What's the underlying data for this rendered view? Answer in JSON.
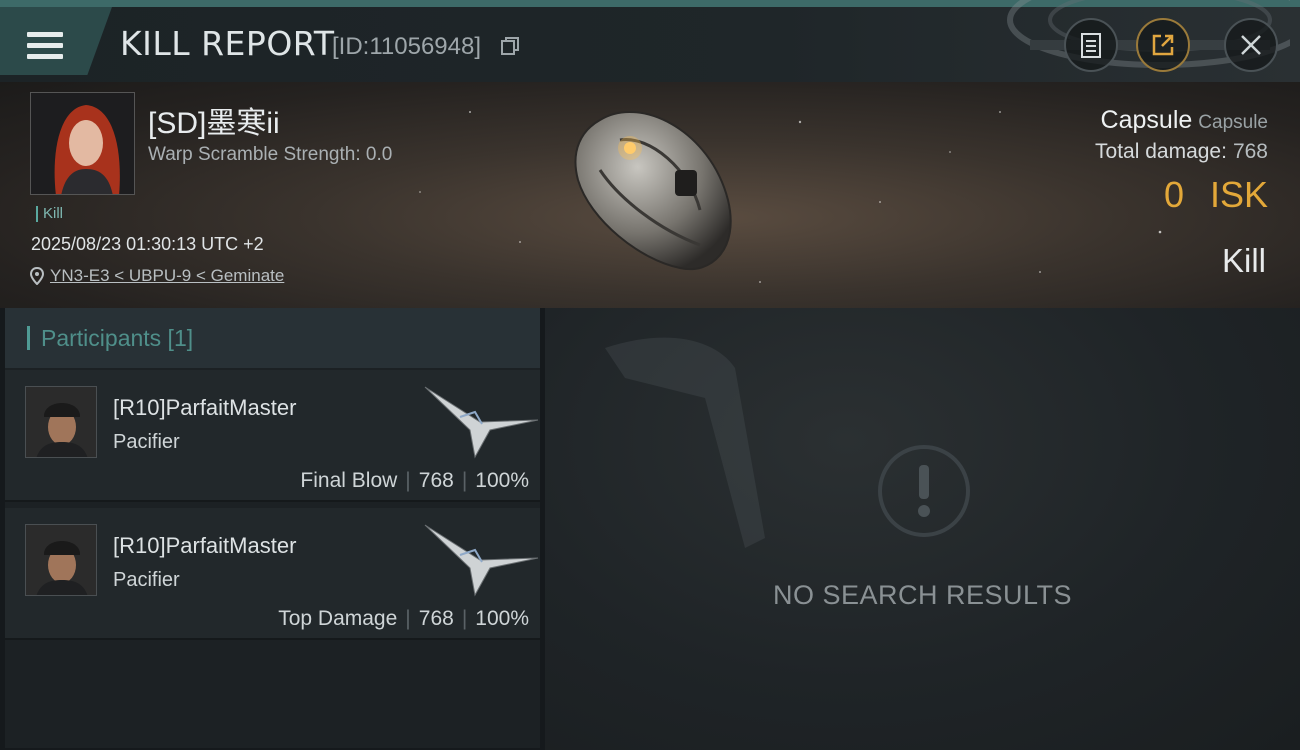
{
  "header": {
    "title": "KILL REPORT",
    "report_id": "[ID:11056948]",
    "icons": [
      "menu-icon",
      "copy-icon",
      "clipboard-icon",
      "share-icon",
      "close-icon"
    ]
  },
  "victim": {
    "name": "[SD]墨寒ii",
    "warp_scramble": "Warp Scramble Strength: 0.0",
    "tag": "Kill",
    "timestamp": "2025/08/23 01:30:13 UTC +2",
    "location": "YN3-E3 < UBPU-9 < Geminate",
    "ship_name": "Capsule",
    "ship_type": "Capsule",
    "total_damage_label": "Total damage:",
    "total_damage": "768",
    "isk_value": "0",
    "isk_label": "ISK",
    "kill_type": "Kill"
  },
  "participants": {
    "title": "Participants [1]",
    "rows": [
      {
        "name": "[R10]ParfaitMaster",
        "ship": "Pacifier",
        "role": "Final Blow",
        "damage": "768",
        "percent": "100%"
      },
      {
        "name": "[R10]ParfaitMaster",
        "ship": "Pacifier",
        "role": "Top Damage",
        "damage": "768",
        "percent": "100%"
      }
    ]
  },
  "results": {
    "empty_text": "NO SEARCH RESULTS"
  },
  "colors": {
    "accent_teal": "#4f9b95",
    "isk_gold": "#e3a839",
    "panel_bg": "#1c2124"
  }
}
